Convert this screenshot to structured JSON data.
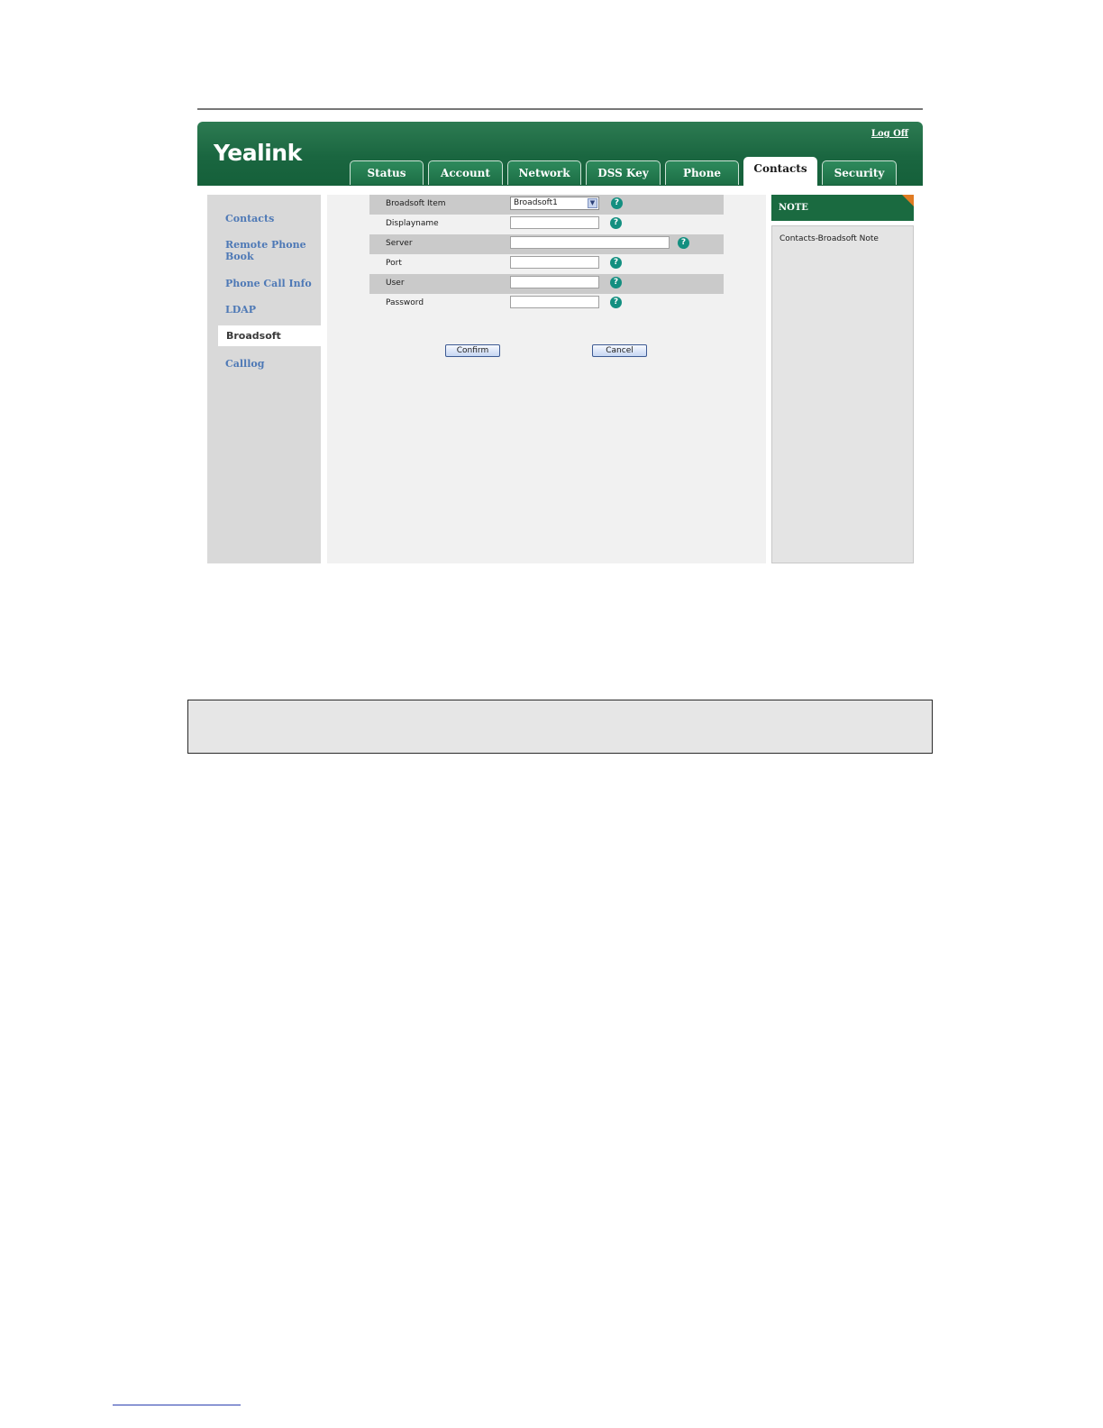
{
  "header": {
    "logo": "Yealink",
    "logoff": "Log Off"
  },
  "tabs": [
    {
      "label": "Status"
    },
    {
      "label": "Account"
    },
    {
      "label": "Network"
    },
    {
      "label": "DSS Key"
    },
    {
      "label": "Phone"
    },
    {
      "label": "Contacts",
      "active": true
    },
    {
      "label": "Security"
    }
  ],
  "sidebar": {
    "items": [
      {
        "label": "Contacts"
      },
      {
        "label": "Remote Phone Book"
      },
      {
        "label": "Phone Call Info"
      },
      {
        "label": "LDAP"
      },
      {
        "label": "Broadsoft",
        "active": true
      },
      {
        "label": "Calllog"
      }
    ]
  },
  "form": {
    "broadsoft_item": {
      "label": "Broadsoft Item",
      "value": "Broadsoft1"
    },
    "displayname": {
      "label": "Displayname",
      "value": ""
    },
    "server": {
      "label": "Server",
      "value": ""
    },
    "port": {
      "label": "Port",
      "value": ""
    },
    "user": {
      "label": "User",
      "value": ""
    },
    "password": {
      "label": "Password",
      "value": ""
    },
    "help_glyph": "?",
    "confirm_label": "Confirm",
    "cancel_label": "Cancel"
  },
  "note": {
    "title": "NOTE",
    "text": "Contacts-Broadsoft Note"
  },
  "colors": {
    "header_green": "#1a6640",
    "help_teal": "#138f80",
    "sidebar_link": "#4e79b6",
    "note_corner": "#e07b22"
  }
}
